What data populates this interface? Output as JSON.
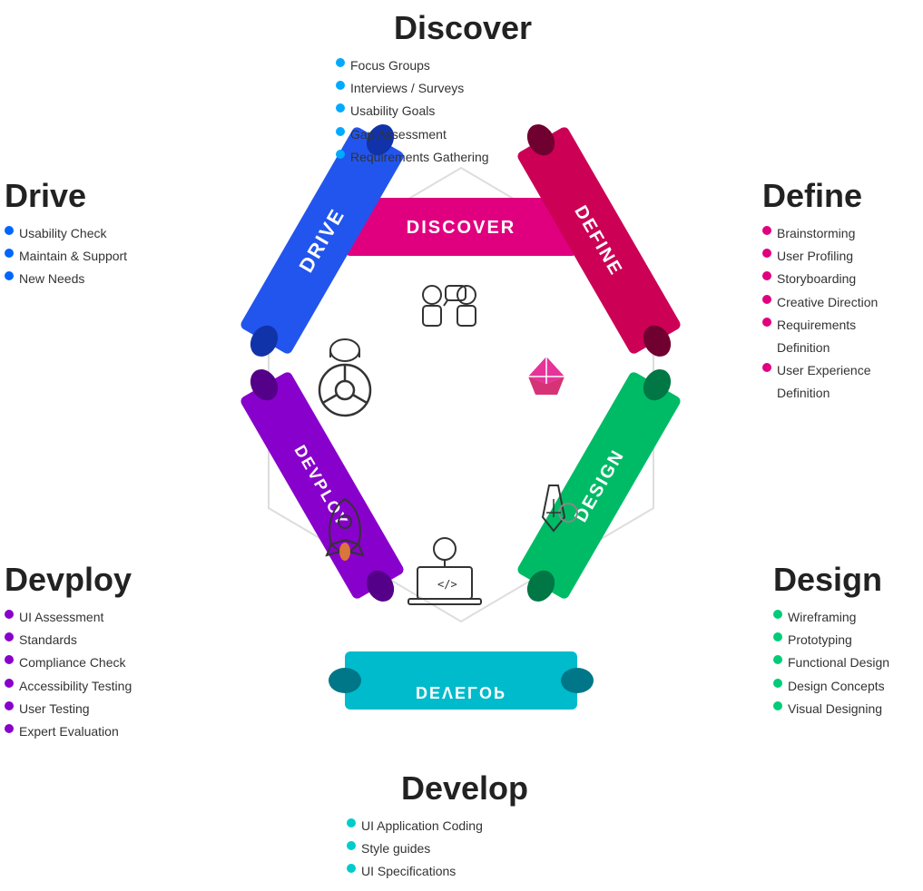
{
  "discover": {
    "title": "Discover",
    "color": "#e0007f",
    "bullet_color": "#00aaff",
    "items": [
      "Focus Groups",
      "Interviews / Surveys",
      "Usability Goals",
      "Gap Assessment",
      "Requirements Gathering"
    ]
  },
  "define": {
    "title": "Define",
    "color": "#cc0055",
    "bullet_color": "#e0007f",
    "items": [
      "Brainstorming",
      "User Profiling",
      "Storyboarding",
      "Creative Direction",
      "Requirements Definition",
      "User Experience Definition"
    ]
  },
  "design": {
    "title": "Design",
    "color": "#00cc77",
    "bullet_color": "#00cc77",
    "items": [
      "Wireframing",
      "Prototyping",
      "Functional Design",
      "Design Concepts",
      "Visual Designing"
    ]
  },
  "develop": {
    "title": "Develop",
    "color": "#00cccc",
    "bullet_color": "#00cccc",
    "items": [
      "UI Application Coding",
      "Style guides",
      "UI Specifications"
    ]
  },
  "devploy": {
    "title": "Devploy",
    "color": "#8800cc",
    "bullet_color": "#8800cc",
    "items": [
      "UI Assessment",
      "Standards",
      "Compliance Check",
      "Accessibility Testing",
      "User Testing",
      "Expert Evaluation"
    ]
  },
  "drive": {
    "title": "Drive",
    "color": "#0066ff",
    "bullet_color": "#0066ff",
    "items": [
      "Usability Check",
      "Maintain & Support",
      "New Needs"
    ]
  },
  "ribbon_labels": {
    "discover": "DISCOVER",
    "define": "DEFINE",
    "design": "DESIGN",
    "develop": "DEVELOP",
    "devploy": "DEVPLOY",
    "drive": "DRIVE"
  }
}
